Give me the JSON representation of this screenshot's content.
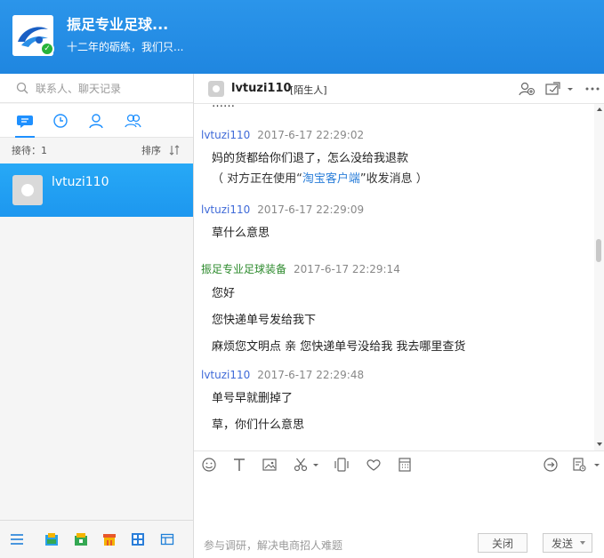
{
  "header": {
    "shop_name": "振足专业足球...",
    "slogan": "十二年的砺练，我们只..."
  },
  "sidebar": {
    "search_placeholder": "联系人、聊天记录",
    "tabs": [
      "chat-icon",
      "clock-icon",
      "person-icon",
      "group-icon"
    ],
    "reception_label": "接待：1",
    "sort_label": "排序",
    "contacts": [
      {
        "name": "lvtuzi110"
      }
    ],
    "bottom_icons": [
      "menu-icon",
      "app-icon-1",
      "app-icon-2",
      "shop-icon",
      "grid-app-icon",
      "window-icon"
    ]
  },
  "chat": {
    "contact_name": "lvtuzi110",
    "contact_tag": "[陌生人]",
    "clipped_text": "……",
    "messages": [
      {
        "sender": "lvtuzi110",
        "time": "2017-6-17 22:29:02",
        "lines": [
          "妈的货都给你们退了，怎么没给我退款"
        ],
        "system_prefix": "（ 对方正在使用“",
        "system_link": "淘宝客户端",
        "system_suffix": "”收发消息 ）"
      },
      {
        "sender": "lvtuzi110",
        "time": "2017-6-17 22:29:09",
        "lines": [
          "草什么意思"
        ]
      },
      {
        "sender": "振足专业足球装备",
        "time": "2017-6-17 22:29:14",
        "lines": [
          "您好",
          "您快递单号发给我下",
          "麻烦您文明点 亲  您快递单号没给我 我去哪里查货"
        ]
      },
      {
        "sender": "lvtuzi110",
        "time": "2017-6-17 22:29:48",
        "lines": [
          "单号早就删掉了",
          "草，你们什么意思"
        ]
      }
    ]
  },
  "toolbar_icons": [
    "emoji-icon",
    "text-icon",
    "image-icon",
    "scissors-icon",
    "shake-icon",
    "heart-icon",
    "calculator-icon",
    "transfer-icon",
    "history-icon"
  ],
  "footer": {
    "survey": "参与调研，解决电商招人难题",
    "close_label": "关闭",
    "send_label": "发送"
  },
  "colors": {
    "accent": "#1e90ff",
    "header": "#2b95ea",
    "buyer": "#3f6ad8",
    "seller": "#2e8b2e"
  }
}
